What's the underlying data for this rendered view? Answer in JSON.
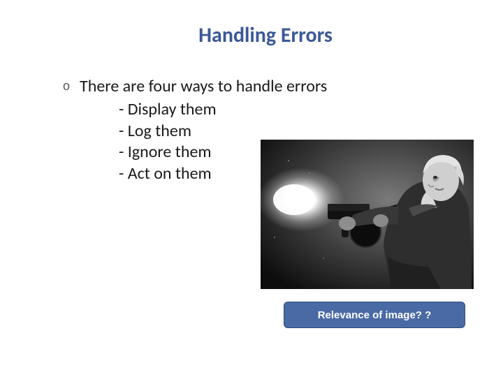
{
  "slide": {
    "title": "Handling Errors",
    "bullet_marker": "o",
    "main_bullet": "There are four ways to handle errors",
    "sub_items": [
      "- Display them",
      "- Log them",
      "- Ignore them",
      "- Act on them"
    ],
    "image_alt": "grayscale-photo-person-firing-weapon",
    "caption": "Relevance of image? ?"
  }
}
